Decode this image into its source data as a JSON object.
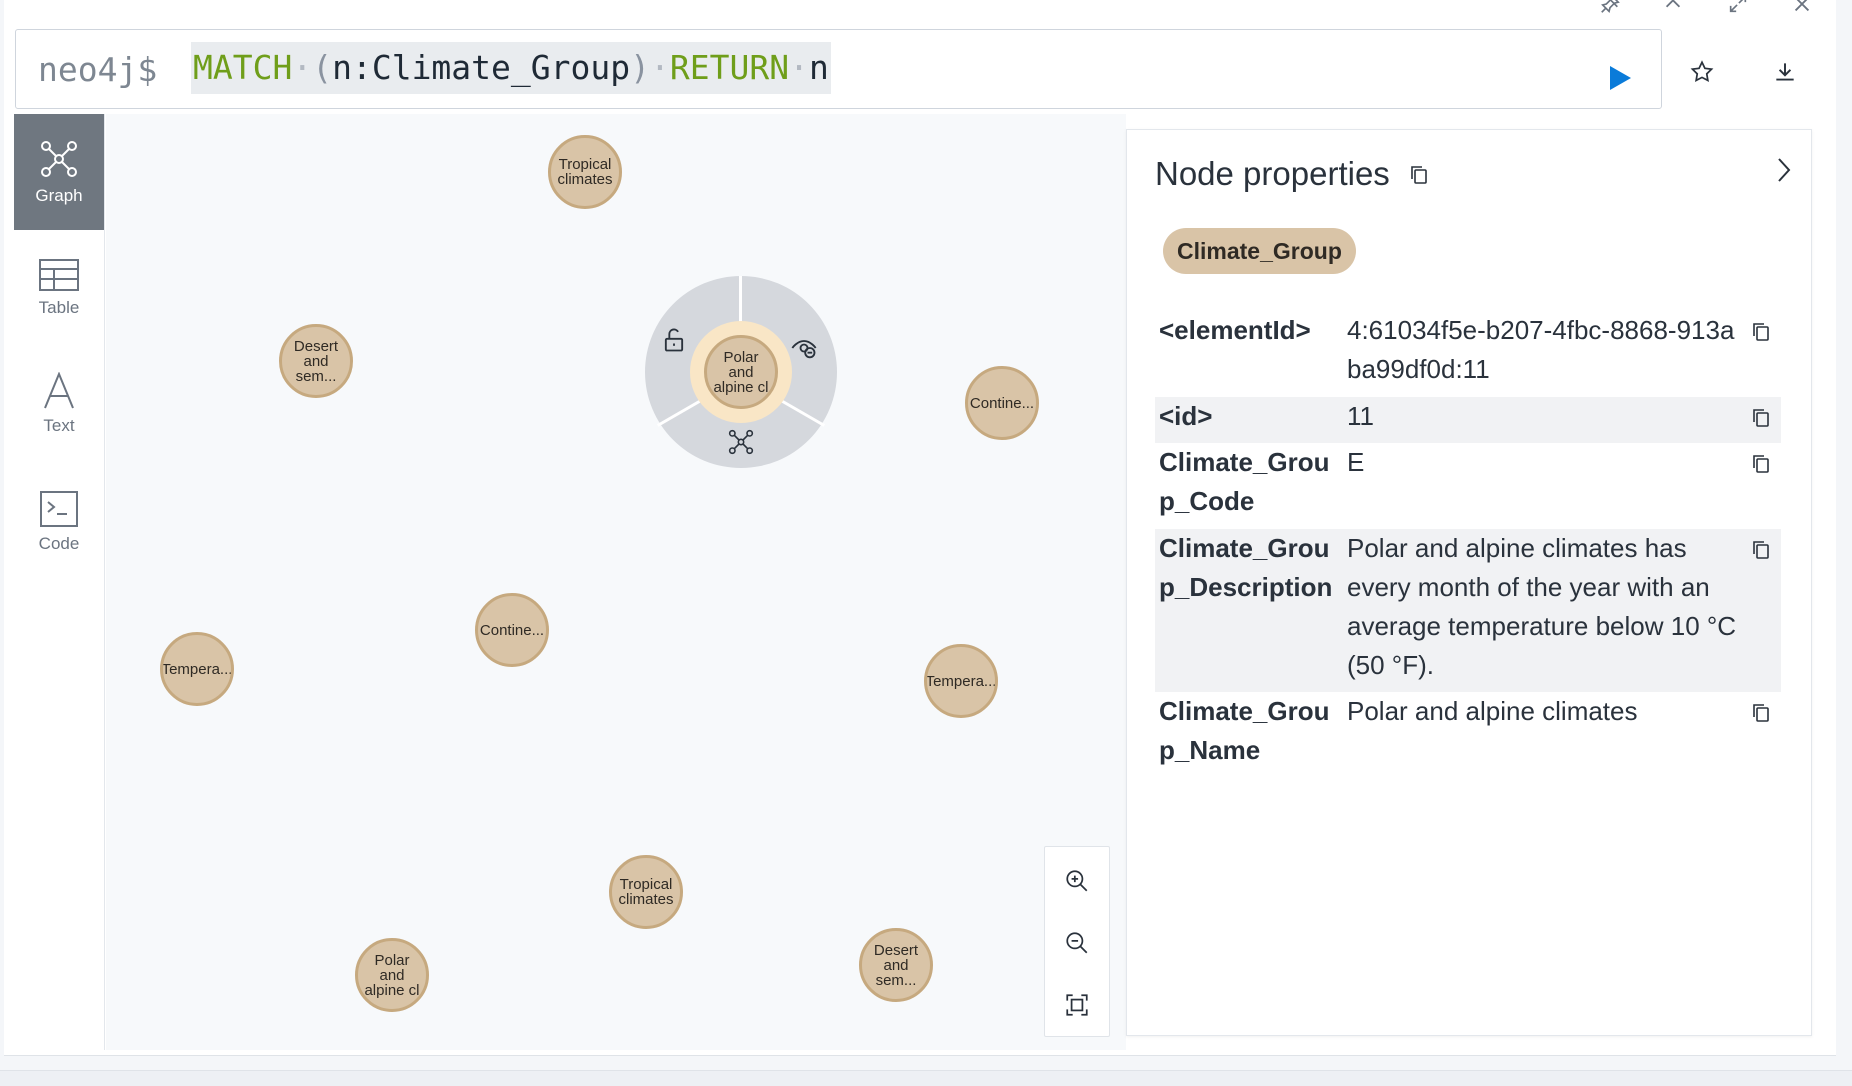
{
  "window_controls": [
    {
      "name": "pin-icon"
    },
    {
      "name": "chevron-up-icon"
    },
    {
      "name": "expand-icon"
    },
    {
      "name": "close-icon"
    }
  ],
  "editor": {
    "prompt": "neo4j$",
    "query_parts": {
      "kw1": "MATCH",
      "open": "(",
      "pattern": "n:Climate_Group",
      "close": ")",
      "kw2": "RETURN",
      "var": "n"
    },
    "accent_color": "#0a7bd9"
  },
  "sidebar": {
    "items": [
      {
        "label": "Graph",
        "icon": "graph-icon",
        "active": true
      },
      {
        "label": "Table",
        "icon": "table-icon"
      },
      {
        "label": "Text",
        "icon": "text-icon"
      },
      {
        "label": "Code",
        "icon": "code-icon"
      }
    ]
  },
  "graph": {
    "node_color": "#d9c4a7",
    "node_border": "#c6a97f",
    "nodes": [
      {
        "label": "Tropical climates"
      },
      {
        "label": "Desert and sem..."
      },
      {
        "label": "Contine..."
      },
      {
        "label": "Contine..."
      },
      {
        "label": "Tempera..."
      },
      {
        "label": "Tempera..."
      },
      {
        "label": "Tropical climates"
      },
      {
        "label": "Polar and alpine cl"
      },
      {
        "label": "Desert and sem..."
      }
    ],
    "selected_node": {
      "label": "Polar and alpine cl"
    }
  },
  "properties": {
    "title": "Node properties",
    "label_chip": "Climate_Group",
    "rows": [
      {
        "key": "<elementId>",
        "value": "4:61034f5e-b207-4fbc-8868-913aba99df0d:11"
      },
      {
        "key": "<id>",
        "value": "11"
      },
      {
        "key": "Climate_Group_Code",
        "value": "E"
      },
      {
        "key": "Climate_Group_Description",
        "value": "Polar and alpine climates has every month of the year with an average temperature below 10 °C (50 °F)."
      },
      {
        "key": "Climate_Group_Name",
        "value": "Polar and alpine climates"
      }
    ]
  }
}
